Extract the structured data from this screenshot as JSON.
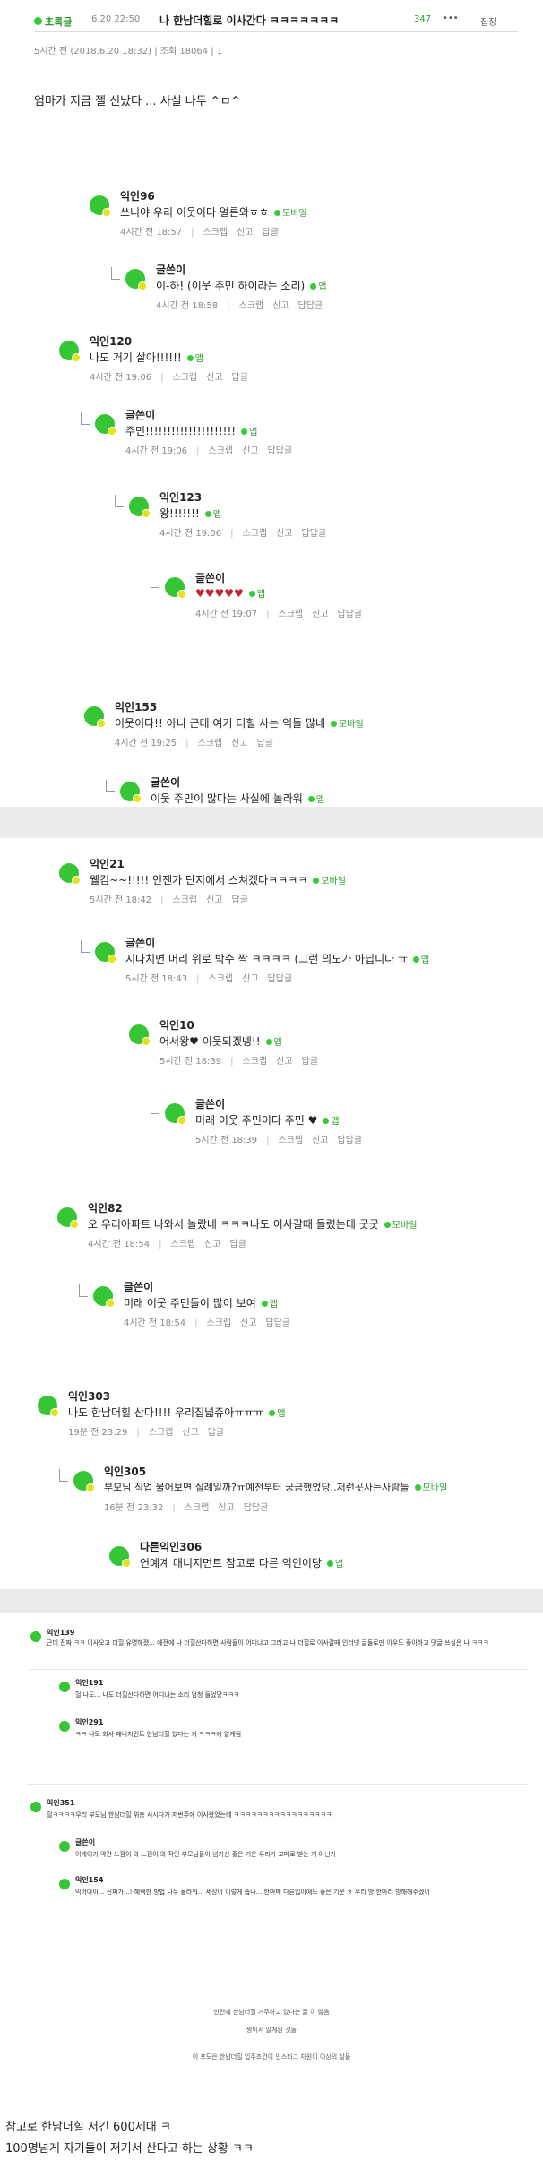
{
  "post": {
    "category": "초록글",
    "date": "6.20 22:50",
    "title": "나 한남더힐로 이사간다 ㅋㅋㅋㅋㅋㅋㅋ",
    "count": "347",
    "report": "집장",
    "meta": "5시간 전 (2018.6.20 18:32) | 조회 18064 | 1",
    "body": "엄마가 지금 젤 신났다 ... 사실 나두 ^ㅁ^"
  },
  "actions": {
    "scrap": "스크랩",
    "report": "신고",
    "reply": "답글",
    "rereply": "답답글"
  },
  "devices": {
    "mobile": "모바일",
    "app": "앱"
  },
  "comments1": [
    {
      "nick": "익인96",
      "text": "쓰니야 우리 이웃이다 얼른와ㅎㅎ",
      "dev": "모바일",
      "time": "4시간 전 18:57"
    },
    {
      "nick": "글쓴이",
      "text": "이-하! (이웃 주민 하이라는 소리)",
      "dev": "앱",
      "time": "4시간 전 18:58"
    },
    {
      "nick": "익인120",
      "text": "나도 거기 살아!!!!!!",
      "dev": "앱",
      "time": "4시간 전 19:06"
    },
    {
      "nick": "글쓴이",
      "text": "주민!!!!!!!!!!!!!!!!!!!!!",
      "dev": "앱",
      "time": "4시간 전 19:06"
    },
    {
      "nick": "익인123",
      "text": "왕!!!!!!!",
      "dev": "앱",
      "time": "4시간 전 19:06"
    },
    {
      "nick": "글쓴이",
      "text": "♥♥♥♥♥",
      "dev": "앱",
      "time": "4시간 전 19:07"
    },
    {
      "nick": "익인155",
      "text": "이웃이다!! 아니 근데 여기 더힐 사는 익들 많네",
      "dev": "모바일",
      "time": "4시간 전 19:25"
    },
    {
      "nick": "글쓴이",
      "text": "이웃 주민이 많다는 사실에 놀라워",
      "dev": "앱",
      "time": ""
    }
  ],
  "comments2": [
    {
      "nick": "익인21",
      "text": "웰컴~~!!!!! 언젠가 단지에서 스쳐겠다ㅋㅋㅋㅋ",
      "dev": "모바일",
      "time": "5시간 전 18:42"
    },
    {
      "nick": "글쓴이",
      "text": "지나치면 머리 위로 박수 짝 ㅋㅋㅋㅋ (그런 의도가 아닙니다 ㅠ",
      "dev": "앱",
      "time": "5시간 전 18:43"
    },
    {
      "nick": "익인10",
      "text": "어서왕♥ 이웃되겠넹!!",
      "dev": "앱",
      "time": "5시간 전 18:39"
    },
    {
      "nick": "글쓴이",
      "text": "미래 이웃 주민이다 주민 ♥",
      "dev": "앱",
      "time": "5시간 전 18:39"
    },
    {
      "nick": "익인82",
      "text": "오 우리아파트 나와서 놀랐네 ㅋㅋㅋ나도 이사갈때 들렸는데 굿굿",
      "dev": "모바일",
      "time": "4시간 전 18:54"
    },
    {
      "nick": "글쓴이",
      "text": "미래 이웃 주민들이 많이 보여",
      "dev": "앱",
      "time": "4시간 전 18:54"
    },
    {
      "nick": "익인303",
      "text": "나도 한남더힐 산다!!!! 우리집넓쥬아ㅠㅠㅠ",
      "dev": "앱",
      "time": "19분 전 23:29"
    },
    {
      "nick": "익인305",
      "text": "부모님 직업 물어보면 실례일까?ㅠ예전부터 궁금했었당..저런곳사는사람들",
      "dev": "모바일",
      "time": "16분 전 23:32"
    },
    {
      "nick": "다른익인306",
      "text": "연예계 매니지먼트 참고로 다른 익인이당",
      "dev": "앱",
      "time": ""
    }
  ],
  "comments3": [
    {
      "nick": "익인139",
      "text": "근데 진짜 ㅋㅋ 이사오고 더힐 유명해졌... 예전에 나 더힐산다하면 사람들이 어디냐고 그러고 나 더힐로 이사갈때 인터넷 글들로만 이우도 좋아하고 댓글 쓰실은 나 ㅋㅋㅋ",
      "time": ""
    },
    {
      "nick": "익인191",
      "text": "헐 나도... 나도 더힐산다하면 어디냐는 소리 엄청 들었당ㅋㅋㅋ",
      "time": ""
    },
    {
      "nick": "익인291",
      "text": "ㅋㅋ 나도 회사 매니지먼트 한남더힐 있다는 거 ㅋㅋㅋ에 알게됨",
      "time": ""
    },
    {
      "nick": "익인351",
      "text": "헐ㅋㅋㅋㅋ우리 부모님 한남더힐 위층 사시다가 저번주에 이사왔었는데 ㅋㅋㅋㅋㅋㅋㅋㅋㅋㅋㅋㅋㅋㅋㅋㅋㅋ",
      "time": ""
    },
    {
      "nick": "글쓴이",
      "text": "이게이거 약간 느낌이 와 느낌이 와 작인 부모님들이 넘가신 좋은 기운 우리가 고마로 받는 거 아닌가",
      "time": ""
    },
    {
      "nick": "익인154",
      "text": "익어야이... 진짜가...! 혜택한 방법 나두 놀라워... 세상이 이렇게 좁나... 한마메 다른입이에도 좋은 기운 ㅎ 우리 방 한마리 방해해주겠어",
      "time": ""
    }
  ],
  "notes": [
    "인턴에 한남더힐 거주하고 있다는 글 이 많음",
    "쌍이서 알게된 것들",
    "이 포도은 한남더힐 입주조건이 인스타그 차원이 이상의 삶들"
  ],
  "footer": {
    "line1": "참고로 한남더힐 저긴 600세대 ㅋ",
    "line2": "100명넘게 자기들이 저기서 산다고 하는 상황 ㅋㅋ"
  }
}
